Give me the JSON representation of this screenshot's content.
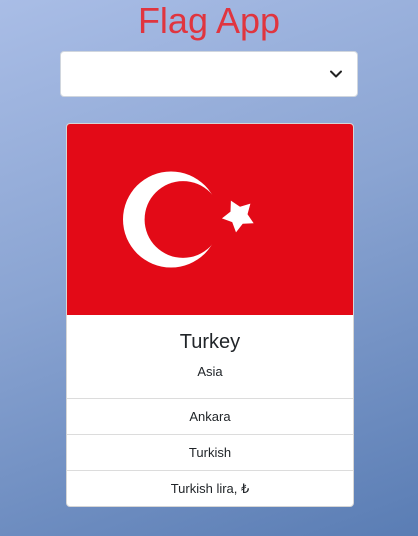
{
  "app": {
    "title": "Flag App"
  },
  "country_select": {
    "selected_value": ""
  },
  "country": {
    "name": "Turkey",
    "region": "Asia",
    "capital": "Ankara",
    "language": "Turkish",
    "currency": "Turkish lira, ₺"
  },
  "flag": {
    "background_color": "#e30a17",
    "emblem_color": "#ffffff",
    "icon": "crescent-and-star"
  },
  "colors": {
    "title": "#e0353f",
    "text": "#212529",
    "card_border": "#d6d6d6"
  }
}
